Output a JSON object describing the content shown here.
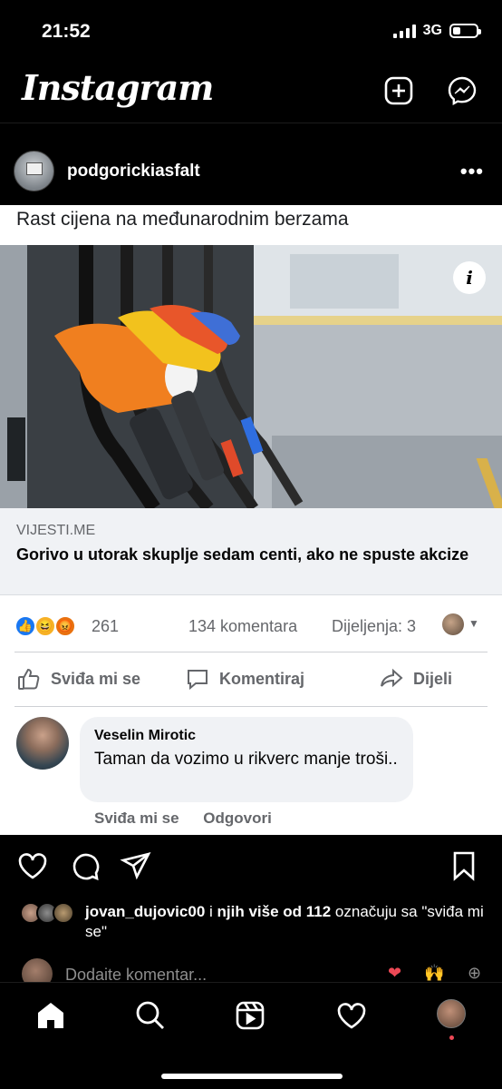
{
  "status_bar": {
    "time": "21:52",
    "network": "3G",
    "battery_level": 0.35
  },
  "header": {
    "logo": "Instagram",
    "icons": [
      "new-post-icon",
      "messenger-icon"
    ]
  },
  "post": {
    "username": "podgorickiasfalt",
    "more_label": "•••",
    "card": {
      "caption": "Rast cijena na međunarodnim berzama",
      "info_label": "i",
      "link": {
        "domain": "VIJESTI.ME",
        "headline": "Gorivo u utorak skuplje sedam centi, ako ne spuste akcize"
      },
      "stats": {
        "reaction_count": "261",
        "comments": "134 komentara",
        "shares": "Dijeljenja: 3"
      },
      "actions": {
        "like": "Sviđa mi se",
        "comment": "Komentiraj",
        "share": "Dijeli"
      },
      "comment": {
        "author": "Veselin Mirotic",
        "text": "Taman da vozimo u rikverc manje troši..",
        "like": "Sviđa mi se",
        "reply": "Odgovori"
      }
    },
    "likes": {
      "user": "jovan_dujovic00",
      "connector": " i ",
      "others": "njih više od 112",
      "suffix": " označuju sa \"sviđa mi se\""
    },
    "add_comment": {
      "placeholder": "Dodaite komentar..."
    }
  },
  "colors": {
    "facebook_blue": "#1877f2",
    "like_red": "#ed4956"
  }
}
